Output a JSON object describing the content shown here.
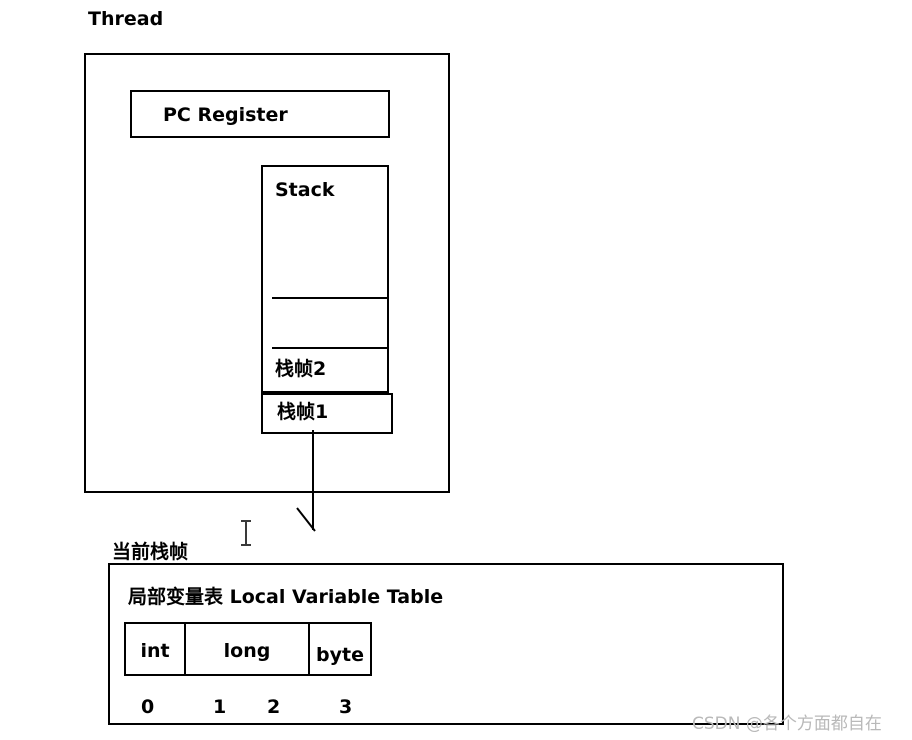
{
  "thread": {
    "title": "Thread",
    "pc_register": "PC Register",
    "stack": {
      "title": "Stack",
      "frames": [
        {
          "label": "栈帧2"
        },
        {
          "label": "栈帧1"
        }
      ]
    }
  },
  "connector": {
    "icon": "down-arrow-icon"
  },
  "cursor": {
    "icon": "text-cursor-icon"
  },
  "current_frame": {
    "title": "当前栈帧",
    "local_variable_table": {
      "title": "局部变量表 Local Variable Table",
      "cells": [
        {
          "type": "int",
          "slots": 1
        },
        {
          "type": "long",
          "slots": 2
        },
        {
          "type": "byte",
          "slots": 1
        }
      ],
      "slot_indices": [
        "0",
        "1",
        "2",
        "3"
      ]
    }
  },
  "watermark": {
    "text": "CSDN @各个方面都自在"
  },
  "colors": {
    "stroke": "#000000",
    "background": "#ffffff",
    "watermark": "#b9b9b9"
  }
}
